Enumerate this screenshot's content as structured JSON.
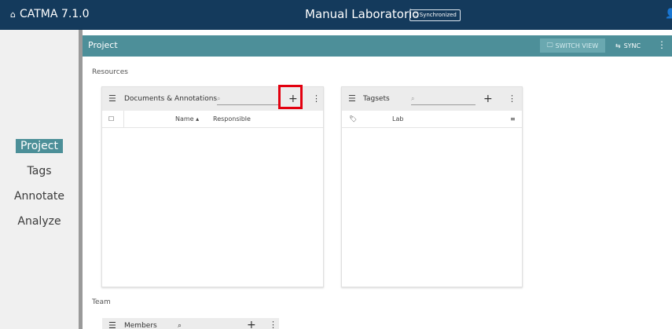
{
  "app": {
    "name": "CATMA 7.1.0",
    "home_icon": "home-icon"
  },
  "header": {
    "project_title": "Manual Laboratorio",
    "sync_status": "Synchronized",
    "user_icon": "user-icon"
  },
  "nav": {
    "items": [
      "Project",
      "Tags",
      "Annotate",
      "Analyze"
    ],
    "active": "Project"
  },
  "project_bar": {
    "label": "Project",
    "switch_view": "SWITCH VIEW",
    "sync": "SYNC"
  },
  "sections": {
    "resources": "Resources",
    "team": "Team"
  },
  "documents_card": {
    "title": "Documents & Annotations",
    "search_placeholder": "⌕",
    "columns": {
      "name": "Name",
      "responsible": "Responsible"
    }
  },
  "tagsets_card": {
    "title": "Tagsets",
    "search_placeholder": "⌕",
    "rows": [
      "Lab"
    ]
  },
  "members_card": {
    "title": "Members",
    "search_placeholder": "⌕"
  },
  "colors": {
    "topbar": "#143a5c",
    "accent": "#4d8f99",
    "highlight": "#e3000f"
  }
}
